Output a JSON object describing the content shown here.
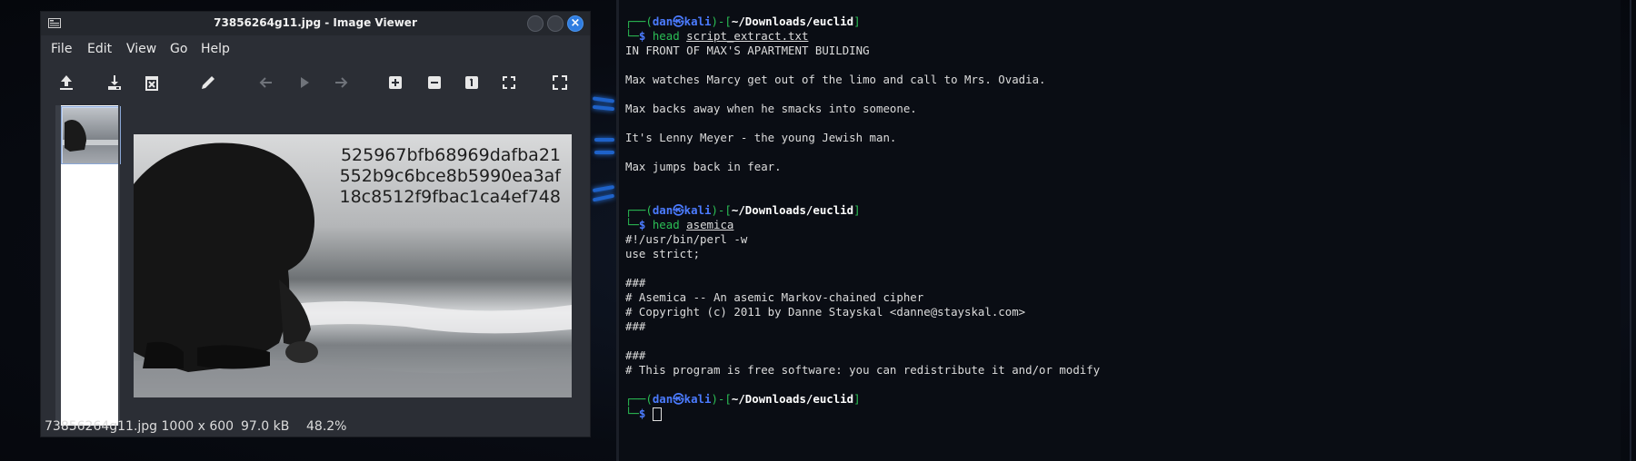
{
  "viewer": {
    "title": "73856264g11.jpg - Image Viewer",
    "menu": [
      "File",
      "Edit",
      "View",
      "Go",
      "Help"
    ],
    "toolbar_icons": [
      "open-icon",
      "save-icon",
      "delete-icon",
      "edit-icon",
      "back-icon",
      "play-icon",
      "forward-icon",
      "zoom-in-icon",
      "zoom-out-icon",
      "zoom-normal-icon",
      "zoom-fit-icon",
      "fullscreen-icon"
    ],
    "photo_hash": [
      "525967bfb68969dafba21",
      "552b9c6bce8b5990ea3af",
      "18c8512f9fbac1ca4ef748"
    ],
    "status": {
      "filename_size": "73856264g11.jpg 1000 x 600",
      "file_size": "97.0 kB",
      "zoom": "48.2%"
    },
    "colors": {
      "close_button": "#2f7de1",
      "thumb_selected": "#c9d7ee"
    }
  },
  "terminal": {
    "prompt1": {
      "user": "dan",
      "host": "kali",
      "path": "~/Downloads/euclid",
      "cmd": "head",
      "arg": "script_extract.txt"
    },
    "output1": [
      "IN FRONT OF MAX'S APARTMENT BUILDING",
      "",
      "Max watches Marcy get out of the limo and call to Mrs. Ovadia.",
      "",
      "Max backs away when he smacks into someone.",
      "",
      "It's Lenny Meyer - the young Jewish man.",
      "",
      "Max jumps back in fear."
    ],
    "prompt2": {
      "user": "dan",
      "host": "kali",
      "path": "~/Downloads/euclid",
      "cmd": "head",
      "arg": "asemica"
    },
    "output2": [
      "#!/usr/bin/perl -w",
      "use strict;",
      "",
      "###",
      "# Asemica -- An asemic Markov-chained cipher",
      "# Copyright (c) 2011 by Danne Stayskal <danne@stayskal.com>",
      "###",
      "",
      "###",
      "# This program is free software: you can redistribute it and/or modify"
    ],
    "prompt3": {
      "user": "dan",
      "host": "kali",
      "path": "~/Downloads/euclid"
    },
    "colors": {
      "prompt_green": "#2bbf55",
      "user_blue": "#4b7bff"
    }
  }
}
